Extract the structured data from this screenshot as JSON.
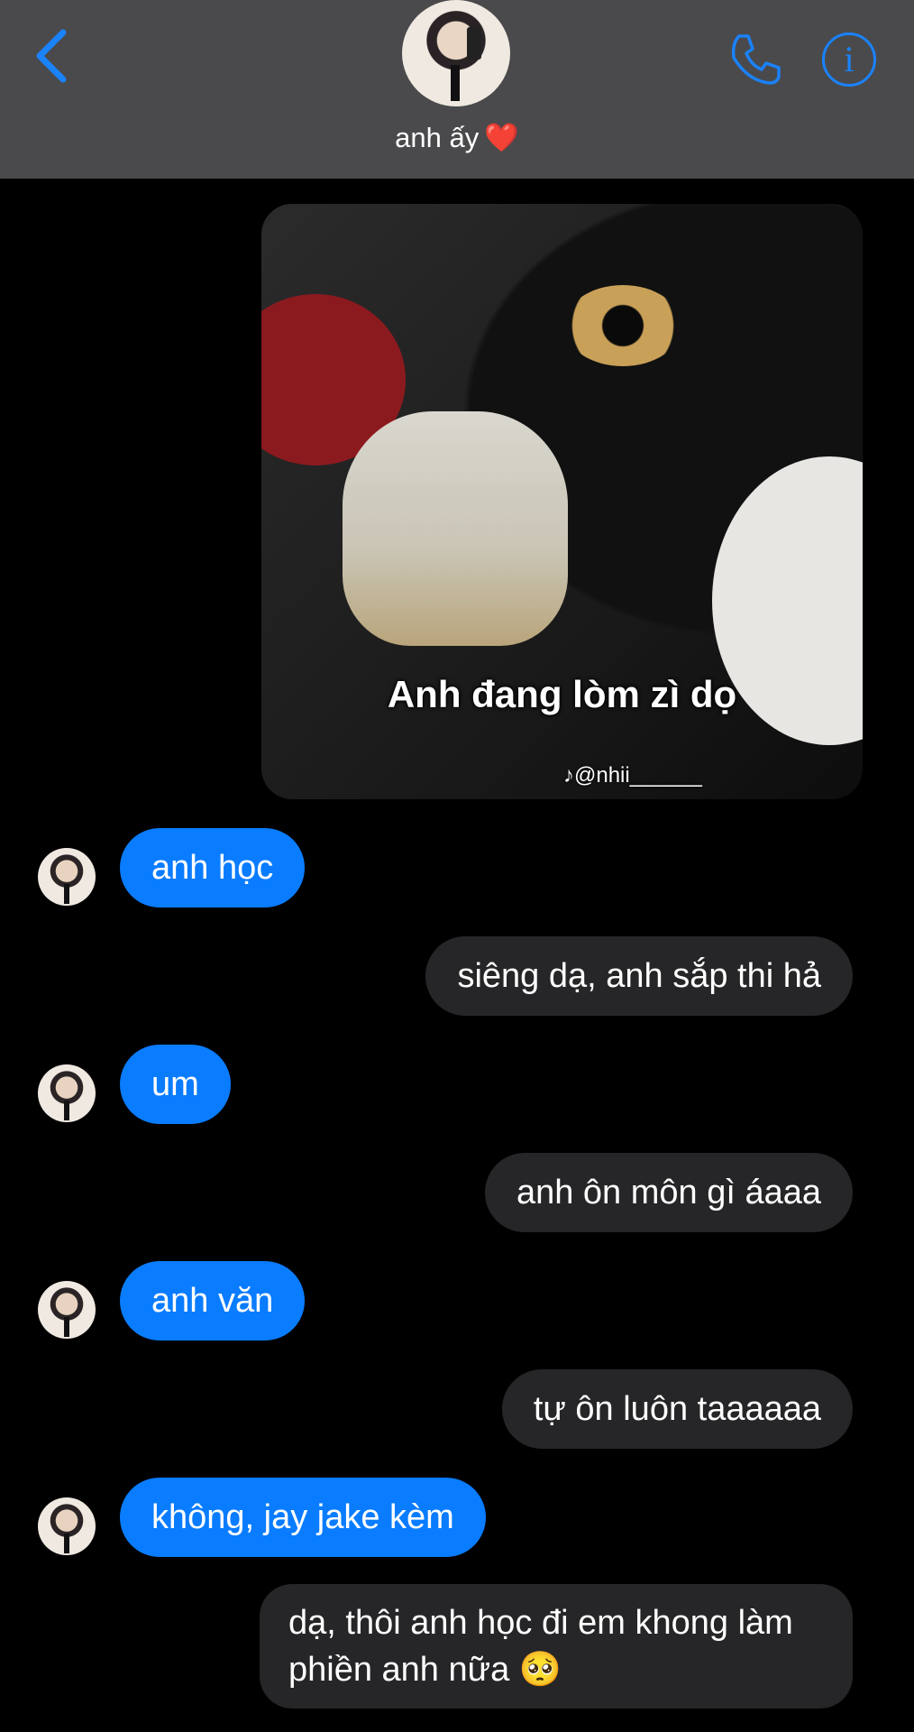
{
  "header": {
    "contact_name": "anh ấy",
    "heart": "❤️",
    "icons": {
      "back": "chevron-left-icon",
      "call": "phone-icon",
      "info": "info-icon"
    },
    "info_glyph": "i",
    "accent_color": "#1a82fb",
    "background_color": "#4a4a4c"
  },
  "image_message": {
    "caption": "Anh đang lòm zì dọ",
    "watermark": "♪@nhii______"
  },
  "messages": [
    {
      "direction": "incoming",
      "text": "anh học"
    },
    {
      "direction": "outgoing",
      "text": "siêng dạ, anh sắp thi hả"
    },
    {
      "direction": "incoming",
      "text": "um"
    },
    {
      "direction": "outgoing",
      "text": "anh ôn môn gì áaaa"
    },
    {
      "direction": "incoming",
      "text": "anh văn"
    },
    {
      "direction": "outgoing",
      "text": "tự ôn luôn taaaaaa"
    },
    {
      "direction": "incoming",
      "text": "không, jay jake kèm"
    },
    {
      "direction": "outgoing",
      "text": "dạ, thôi anh học đi em khong làm phiền anh nữa 🥺"
    }
  ],
  "colors": {
    "incoming_bubble": "#0a7cff",
    "outgoing_bubble": "#262628",
    "background": "#000000"
  }
}
